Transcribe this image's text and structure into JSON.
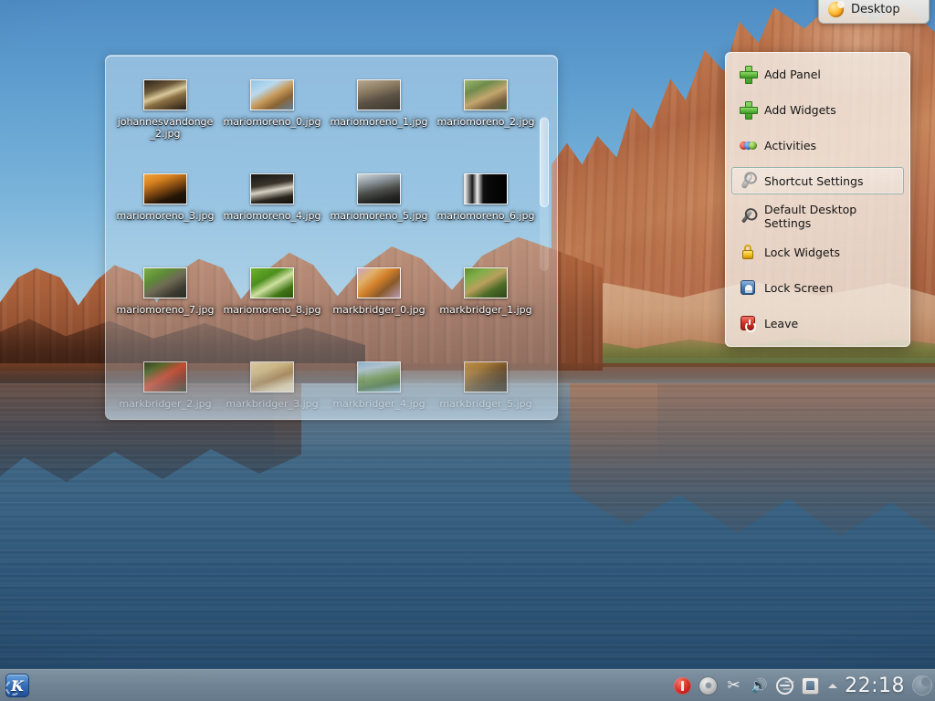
{
  "desktop": {
    "wallpaper_name": "Lake Powell canyon",
    "colors": {
      "sky_top": "#4e8cc4",
      "sky_bottom": "#c5dbe6",
      "rock": "#b5643d",
      "water_top": "#5d7b92",
      "water_bottom": "#224668",
      "panel": "#76889 8",
      "accent_selection": "#80a6a6"
    }
  },
  "toolbox": {
    "label": "Desktop",
    "icon": "plasma-cashew-icon"
  },
  "context_menu": {
    "items": [
      {
        "label": "Add Panel",
        "icon": "plus-icon",
        "selected": false
      },
      {
        "label": "Add Widgets",
        "icon": "plus-icon",
        "selected": false
      },
      {
        "label": "Activities",
        "icon": "activities-balls-icon",
        "selected": false
      },
      {
        "label": "Shortcut Settings",
        "icon": "wrench-light-icon",
        "selected": true
      },
      {
        "label": "Default Desktop Settings",
        "icon": "wrench-dark-icon",
        "selected": false
      },
      {
        "label": "Lock Widgets",
        "icon": "padlock-icon",
        "selected": false
      },
      {
        "label": "Lock Screen",
        "icon": "lock-screen-icon",
        "selected": false
      },
      {
        "label": "Leave",
        "icon": "power-icon",
        "selected": false
      }
    ]
  },
  "folder_view": {
    "scrollbar_visible": true,
    "files": [
      {
        "name": "johannesvandonge_2.jpg",
        "thumb": "linear-gradient(160deg,#2b2118 0%,#6d5a3a 30%,#d8c79a 48%,#8a6f42 62%,#241a12 100%)",
        "faded": false
      },
      {
        "name": "mariomoreno_0.jpg",
        "thumb": "linear-gradient(150deg,#8fc4e6 0%,#b9d9ee 30%,#c79a5a 52%,#8a6434 72%,#5d7fa0 100%)",
        "faded": false
      },
      {
        "name": "mariomoreno_1.jpg",
        "thumb": "linear-gradient(165deg,#b9a88e 0%,#8a7a62 34%,#5c5245 60%,#3a352c 100%)",
        "faded": false
      },
      {
        "name": "mariomoreno_2.jpg",
        "thumb": "linear-gradient(155deg,#9ab870 0%,#6f8c4c 28%,#c3a66e 54%,#7a6340 76%,#4a5a38 100%)",
        "faded": false
      },
      {
        "name": "mariomoreno_3.jpg",
        "thumb": "linear-gradient(160deg,#f0a43a 0%,#d98320 24%,#7a4410 52%,#251607 74%,#120b04 100%)",
        "faded": false
      },
      {
        "name": "mariomoreno_4.jpg",
        "thumb": "linear-gradient(170deg,#171512 0%,#3b352c 36%,#d8d2c4 54%,#2a251e 78%,#100e0b 100%)",
        "faded": false
      },
      {
        "name": "mariomoreno_5.jpg",
        "thumb": "linear-gradient(168deg,#cfd6da 0%,#8f9aa0 26%,#4d4f4c 54%,#262724 78%,#131412 100%)",
        "faded": false
      },
      {
        "name": "mariomoreno_6.jpg",
        "thumb": "linear-gradient(90deg,#f4f4f4 0%,#1a1a1a 18%,#ececec 30%,#111 44%,#0a0a0a 52%,#000 100%)",
        "faded": false
      },
      {
        "name": "mariomoreno_7.jpg",
        "thumb": "linear-gradient(150deg,#7fae4a 0%,#5d8c36 30%,#6f6a55 52%,#3c3a30 78%,#2a2a22 100%)",
        "faded": false
      },
      {
        "name": "mariomoreno_8.jpg",
        "thumb": "linear-gradient(150deg,#6fb22e 0%,#4c8f1c 34%,#cfe0a0 54%,#3e7414 78%,#2b5410 100%)",
        "faded": false
      },
      {
        "name": "markbridger_0.jpg",
        "thumb": "linear-gradient(140deg,#c7a6c4 0%,#e0b06a 26%,#d4812a 46%,#8a5a2a 68%,#b79ab4 100%)",
        "faded": false
      },
      {
        "name": "markbridger_1.jpg",
        "thumb": "linear-gradient(150deg,#5e8a2c 0%,#7fae48 24%,#b8a05c 48%,#4a6a26 72%,#2d4418 100%)",
        "faded": false
      },
      {
        "name": "markbridger_2.jpg",
        "thumb": "linear-gradient(150deg,#243a18 0%,#4a6a22 22%,#d4462a 48%,#8f3018 68%,#1c2a12 100%)",
        "faded": true
      },
      {
        "name": "markbridger_3.jpg",
        "thumb": "linear-gradient(160deg,#f0e2b8 0%,#ddc88e 30%,#b08a52 56%,#e6d6ac 80%,#f2e8c8 100%)",
        "faded": true
      },
      {
        "name": "markbridger_4.jpg",
        "thumb": "linear-gradient(170deg,#8fc4e6 0%,#b8d8ea 22%,#6f9a4a 52%,#3e6a2c 74%,#7aa8c8 100%)",
        "faded": true
      },
      {
        "name": "markbridger_5.jpg",
        "thumb": "linear-gradient(150deg,#c89a4a 0%,#a87a30 28%,#6a4a1c 52%,#3a2a12 76%,#241a0c 100%)",
        "faded": true
      }
    ]
  },
  "panel": {
    "kickoff_label": "K",
    "tray": [
      {
        "name": "media-player-icon",
        "glyph": ""
      },
      {
        "name": "gear-icon",
        "glyph": ""
      },
      {
        "name": "klipper-scissors-icon",
        "glyph": "✂"
      },
      {
        "name": "volume-speaker-icon",
        "glyph": "🔊"
      },
      {
        "name": "usb-device-icon",
        "glyph": ""
      },
      {
        "name": "device-notifier-icon",
        "glyph": ""
      },
      {
        "name": "show-hidden-arrow-icon",
        "glyph": ""
      }
    ],
    "clock": "22:18",
    "cashew": "panel-cashew-icon"
  }
}
